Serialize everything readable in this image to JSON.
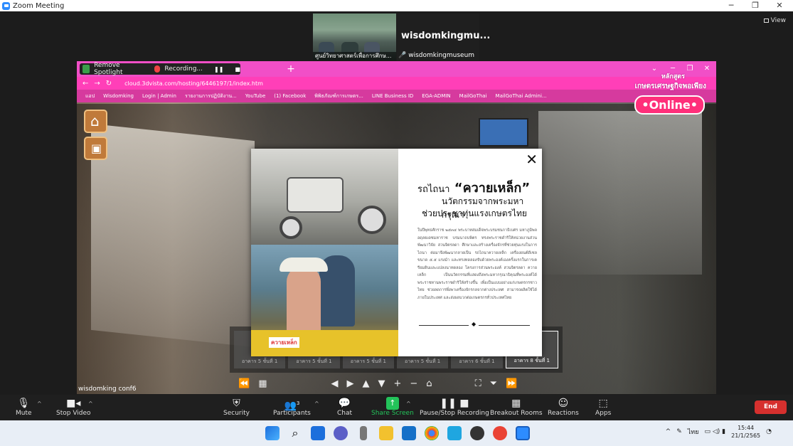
{
  "window": {
    "title": "Zoom Meeting",
    "controls": [
      "─",
      "❐",
      "✕"
    ],
    "view_label": "View"
  },
  "participants_strip": [
    {
      "name": "ศูนย์วิทยาศาสตร์เพื่อการศึกษ..."
    },
    {
      "display": "wisdomkingmu...",
      "name": "wisdomkingmuseum"
    }
  ],
  "shared_screen": {
    "spotlight_label": "Remove Spotlight",
    "recording_label": "Recording...",
    "url": "cloud.3dvista.com/hosting/6446197/1/index.htm",
    "bookmarks": [
      "แอป",
      "Wisdomking",
      "Login | Admin",
      "รายงานการปฏิบัติงาน...",
      "YouTube",
      "(1) Facebook",
      "พิพิธภัณฑ์การเกษตร...",
      "LINE Business ID",
      "EGA-ADMIN",
      "MailGoThai",
      "MailGoThai Admini..."
    ],
    "logo": {
      "line1": "หลักสูตร",
      "line2": "เกษตรเศรษฐกิจพอเพียง",
      "badge": "•Online•"
    },
    "popup": {
      "title_prefix": "รถไถนา",
      "title_main": "“ควายเหล็ก”",
      "subtitle1": "นวัตกรรมจากพระมหากรุณา",
      "subtitle2": "ช่วยประชาทุ่นแรงเกษตรไทย",
      "photo_sign": "ควายเหล็ก",
      "close": "✕",
      "body": "ในปีพุทธศักราช ๒๕๓๔ พระบาทสมเด็จพระบรมชนกาธิเบศร มหาภูมิพลอดุลยเดชมหาราช บรมนาถบพิตร ทรงพระราชดำริให้หน่วยงานส่วนพัฒนาวิจัย สวนจิตรลดา ศึกษาและสร้างเครื่องจักรที่ช่วยทุ่นแรงในการไถนา ต่อมาจึงพัฒนากลายเป็น รถไถนาควายเหล็ก เครื่องยนต์ดีเซล ขนาด ๕.๕ แรงม้า และทรงทดลองขับด้วยพระองค์เองครั้งแรกในการเตรียมดินและแปลงนาทดลอง โครงการส่วนพระองค์ สวนจิตรลดา ควายเหล็ก เป็นนวัตกรรมที่แสดงถึงพระมหากรุณาธิคุณที่พระองค์ได้พระราชทานพระราชดำริให้สร้างขึ้น เพื่อเป็นแบบอย่างแก่เกษตรกรชาวไทย ช่วยลดการพึ่งพาเครื่องจักรกลจากต่างประเทศ สามารถผลิตใช้ได้ภายในประเทศ และส่งผลบวกต่อเกษตรกรทั่วประเทศไทย"
    },
    "thumbs": [
      "อาคาร 5 ชั้นที่ 1",
      "อาคาร 5 ชั้นที่ 1",
      "อาคาร 5 ชั้นที่ 1",
      "อาคาร 5 ชั้นที่ 1",
      "อาคาร 6 ชั้นที่ 1",
      "อาคาร 8 ชั้นที่ 1"
    ],
    "conf_label": "wisdomking conf6"
  },
  "toolbar": {
    "mute": "Mute",
    "stop_video": "Stop Video",
    "security": "Security",
    "participants": "Participants",
    "participants_count": "3",
    "chat": "Chat",
    "share_screen": "Share Screen",
    "pause_recording": "Pause/Stop Recording",
    "breakout": "Breakout Rooms",
    "reactions": "Reactions",
    "apps": "Apps",
    "end": "End"
  },
  "taskbar": {
    "lang": "ไทย",
    "time": "15:44",
    "date": "21/1/2565"
  },
  "colors": {
    "zoom_blue": "#2d8cff",
    "end_red": "#d6302e",
    "share_green": "#23c35a",
    "browser_pink": "#f14fc7"
  }
}
